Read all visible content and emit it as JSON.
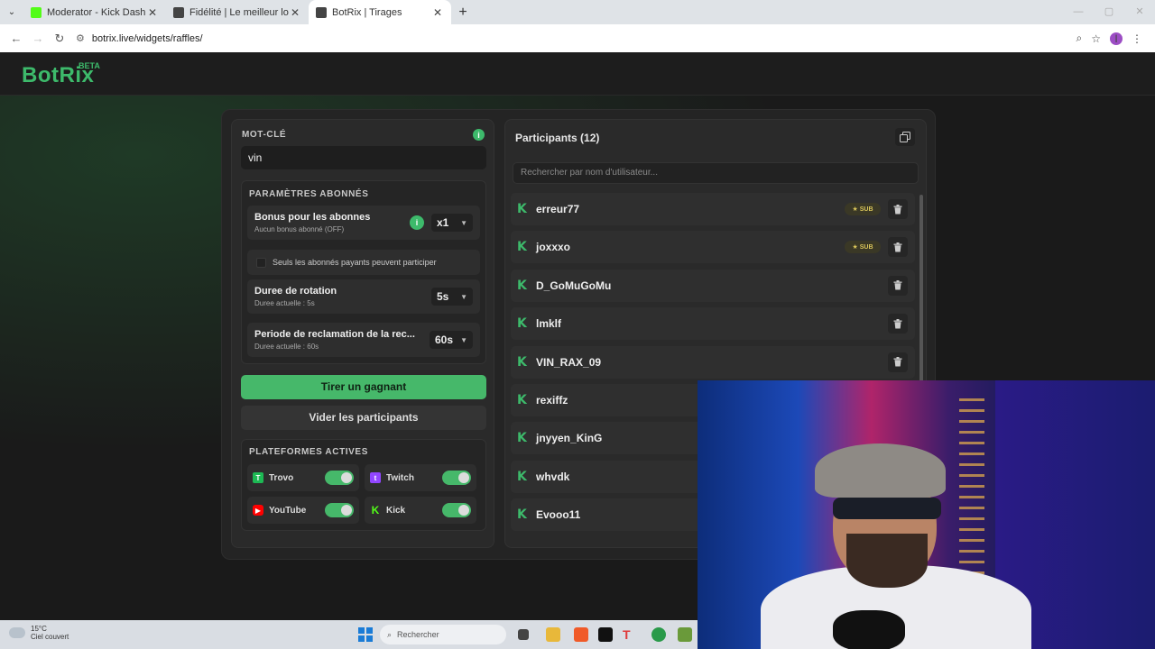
{
  "browser": {
    "tabs": [
      {
        "title": "Moderator - Kick Dashboard",
        "fav_color": "#53fc18"
      },
      {
        "title": "Fidélité | Le meilleur logiciel po",
        "fav_color": "#444444"
      },
      {
        "title": "BotRix | Tirages",
        "fav_color": "#444444"
      }
    ],
    "url": "botrix.live/widgets/raffles/",
    "profile_initial": "I"
  },
  "site": {
    "logo": "BotRix",
    "beta": "BETA"
  },
  "left": {
    "keyword_label": "MOT-CLÉ",
    "keyword_value": "vin",
    "sub_params_label": "PARAMÈTRES ABONNÉS",
    "bonus_title": "Bonus pour les abonnes",
    "bonus_sub": "Aucun bonus abonné (OFF)",
    "bonus_value": "x1",
    "only_subs_label": "Seuls les abonnés payants peuvent participer",
    "rotation_title": "Duree de rotation",
    "rotation_sub": "Duree actuelle : 5s",
    "rotation_value": "5s",
    "claim_title": "Periode de reclamation de la rec...",
    "claim_sub": "Duree actuelle : 60s",
    "claim_value": "60s",
    "draw_button": "Tirer un gagnant",
    "clear_button": "Vider les participants",
    "platforms_label": "PLATEFORMES ACTIVES",
    "platforms": [
      {
        "name": "Trovo",
        "color": "#1db954",
        "enabled": true
      },
      {
        "name": "Twitch",
        "color": "#9146ff",
        "enabled": true
      },
      {
        "name": "YouTube",
        "color": "#ff0000",
        "enabled": true
      },
      {
        "name": "Kick",
        "color": "#53fc18",
        "enabled": true
      }
    ]
  },
  "right": {
    "title": "Participants (12)",
    "search_placeholder": "Rechercher par nom d'utilisateur...",
    "sub_badge": "SUB",
    "participants": [
      {
        "name": "erreur77",
        "sub": true
      },
      {
        "name": "joxxxo",
        "sub": true
      },
      {
        "name": "D_GoMuGoMu",
        "sub": false
      },
      {
        "name": "lmklf",
        "sub": false
      },
      {
        "name": "VIN_RAX_09",
        "sub": false
      },
      {
        "name": "rexiffz",
        "sub": false
      },
      {
        "name": "jnyyen_KinG",
        "sub": false
      },
      {
        "name": "whvdk",
        "sub": false
      },
      {
        "name": "Evooo11",
        "sub": false
      }
    ]
  },
  "taskbar": {
    "temp": "15°C",
    "weather": "Ciel couvert",
    "search": "Rechercher"
  }
}
